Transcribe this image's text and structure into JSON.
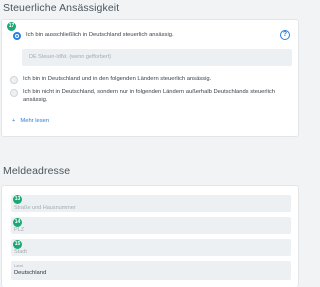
{
  "tax": {
    "title": "Steuerliche Ansässigkeit",
    "badge": "17",
    "options": [
      {
        "label": "Ich bin ausschließlich in Deutschland steuerlich ansässig.",
        "checked": true
      },
      {
        "label": "Ich bin in Deutschland und in den folgenden Ländern steuerlich ansässig.",
        "checked": false
      },
      {
        "label": "Ich bin nicht in Deutschland, sondern nur in folgenden Ländern außerhalb Deutschlands steuerlich ansässig.",
        "checked": false
      }
    ],
    "tax_id_placeholder": "DE Steuer-IdNr. (wenn gefforbert)",
    "help_icon": "?",
    "more_link": "Mehr lesen",
    "plus_icon": "+"
  },
  "address": {
    "title": "Meldeadresse",
    "street": {
      "badge": "13",
      "placeholder": "Straße und Hausnummer"
    },
    "zip": {
      "badge": "14",
      "placeholder": "PLZ"
    },
    "city": {
      "badge": "15",
      "placeholder": "Stadt"
    },
    "country": {
      "label": "Land",
      "value": "Deutschland"
    }
  },
  "colors": {
    "accent": "#2a7de1",
    "badge": "#19a974"
  }
}
